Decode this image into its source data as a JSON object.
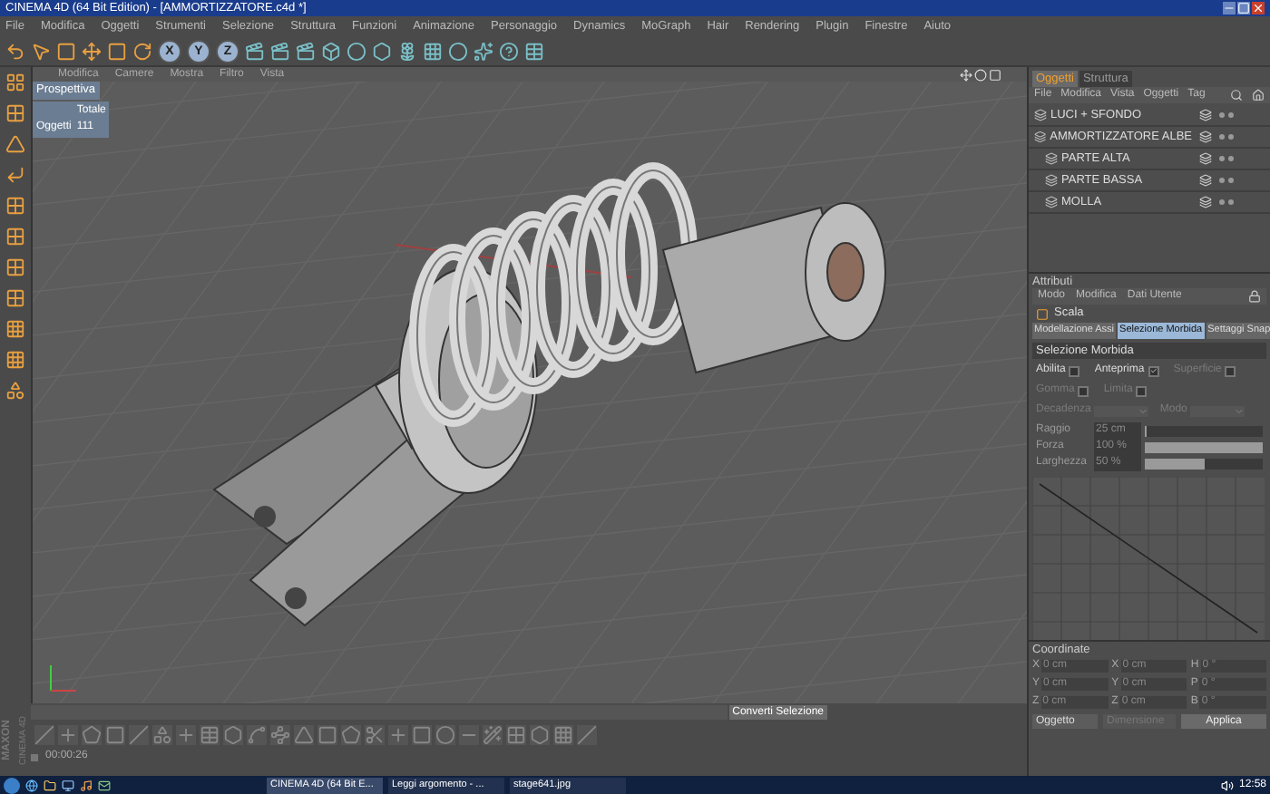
{
  "window": {
    "title": "CINEMA 4D (64 Bit Edition) - [AMMORTIZZATORE.c4d *]"
  },
  "menu_bar": [
    "File",
    "Modifica",
    "Oggetti",
    "Strumenti",
    "Selezione",
    "Struttura",
    "Funzioni",
    "Animazione",
    "Personaggio",
    "Dynamics",
    "MoGraph",
    "Hair",
    "Rendering",
    "Plugin",
    "Finestre",
    "Aiuto"
  ],
  "toolbar": {
    "axis_buttons": [
      {
        "label": "X",
        "selected": true
      },
      {
        "label": "Y",
        "selected": true
      },
      {
        "label": "Z",
        "selected": true
      }
    ]
  },
  "viewport": {
    "menu": [
      "Modifica",
      "Camere",
      "Mostra",
      "Filtro",
      "Vista"
    ],
    "view_name": "Prospettiva",
    "stats": {
      "header": "Totale",
      "label": "Oggetti",
      "value": "111"
    }
  },
  "object_manager": {
    "tabs": [
      {
        "label": "Oggetti",
        "selected": true
      },
      {
        "label": "Struttura",
        "selected": false
      }
    ],
    "menu": [
      "File",
      "Modifica",
      "Vista",
      "Oggetti",
      "Tag"
    ],
    "objects": [
      {
        "name": "LUCI + SFONDO"
      },
      {
        "name": "AMMORTIZZATORE ALBE",
        "children": [
          {
            "name": "PARTE ALTA"
          },
          {
            "name": "PARTE BASSA"
          },
          {
            "name": "MOLLA"
          }
        ]
      }
    ]
  },
  "attributes": {
    "title": "Attributi",
    "menu": [
      "Modo",
      "Modifica",
      "Dati Utente"
    ],
    "object_name": "Scala",
    "tabs": [
      {
        "label": "Modellazione Assi",
        "selected": false
      },
      {
        "label": "Selezione Morbida",
        "selected": true
      },
      {
        "label": "Settaggi Snap",
        "selected": false
      }
    ],
    "section": "Selezione Morbida",
    "checks": [
      {
        "label": "Abilita",
        "checked": false,
        "disabled": false
      },
      {
        "label": "Anteprima",
        "checked": true,
        "disabled": false
      },
      {
        "label": "Superficie",
        "checked": false,
        "disabled": true
      },
      {
        "label": "Gomma",
        "checked": false,
        "disabled": true
      },
      {
        "label": "Limita",
        "checked": false,
        "disabled": true
      }
    ],
    "dropdowns": [
      {
        "label": "Decadenza"
      },
      {
        "label": "Modo"
      }
    ],
    "sliders": [
      {
        "label": "Raggio",
        "value": "25 cm",
        "level": 0.02
      },
      {
        "label": "Forza",
        "value": "100 %",
        "level": 1
      },
      {
        "label": "Larghezza",
        "value": "50 %",
        "level": 0.5
      }
    ]
  },
  "coordinates": {
    "title": "Coordinate",
    "rows": [
      {
        "fields": [
          {
            "axis": "X",
            "value": "0 cm"
          },
          {
            "axis": "X",
            "value": "0 cm"
          },
          {
            "axis": "H",
            "value": "0 °"
          }
        ]
      },
      {
        "fields": [
          {
            "axis": "Y",
            "value": "0 cm"
          },
          {
            "axis": "Y",
            "value": "0 cm"
          },
          {
            "axis": "P",
            "value": "0 °"
          }
        ]
      },
      {
        "fields": [
          {
            "axis": "Z",
            "value": "0 cm"
          },
          {
            "axis": "Z",
            "value": "0 cm"
          },
          {
            "axis": "B",
            "value": "0 °"
          }
        ]
      }
    ],
    "mode": "Oggetto",
    "size": "Dimensione",
    "apply": "Applica"
  },
  "bottom_bar": {
    "convert": "Converti Selezione",
    "time": "00:00:26",
    "brand": "MAXON",
    "product": "CINEMA 4D"
  },
  "taskbar": {
    "items": [
      {
        "label": "CINEMA 4D (64 Bit E...",
        "selected": true
      },
      {
        "label": "Leggi argomento - ...",
        "selected": false
      },
      {
        "label": "stage641.jpg",
        "selected": false
      }
    ],
    "clock": "12:58"
  }
}
